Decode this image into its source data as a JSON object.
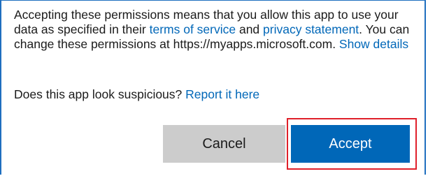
{
  "dialog": {
    "consent_text": {
      "part1": "Accepting these permissions means that you allow this app to use your data as specified in their ",
      "terms_link": "terms of service",
      "part2": " and ",
      "privacy_link": "privacy statement",
      "part3": ". You can change these permissions at https://myapps.microsoft.com. ",
      "details_link": "Show details"
    },
    "suspicious": {
      "question": "Does this app look suspicious? ",
      "report_link": "Report it here"
    },
    "buttons": {
      "cancel_label": "Cancel",
      "accept_label": "Accept"
    }
  },
  "colors": {
    "link": "#0067b8",
    "accept_bg": "#0067b8",
    "cancel_bg": "#cccccc",
    "frame_border": "#1f6fbf",
    "highlight": "#e0202a"
  }
}
